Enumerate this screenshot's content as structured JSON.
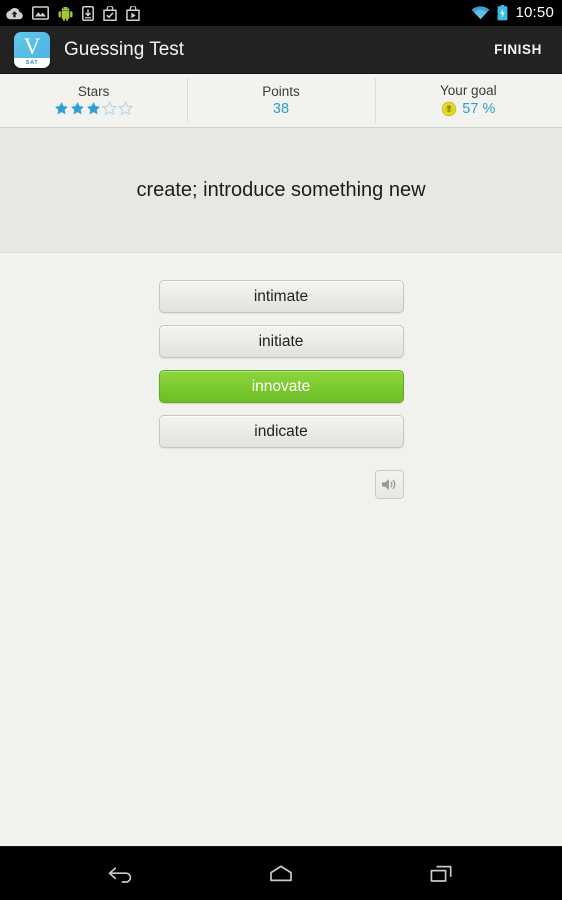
{
  "status_bar": {
    "icons": [
      "cloud-upload-icon",
      "photo-icon",
      "android-icon",
      "download-device-icon",
      "bag-check-icon",
      "bag-play-icon"
    ],
    "wifi_icon": "wifi-icon",
    "battery_icon": "battery-charging-icon",
    "time": "10:50"
  },
  "action_bar": {
    "app_icon": "app-logo-icon",
    "app_icon_letter": "V",
    "app_icon_sub": "SAT",
    "title": "Guessing Test",
    "finish_label": "FINISH"
  },
  "stats": [
    {
      "label": "Stars",
      "type": "stars",
      "filled": 3,
      "total": 5,
      "color": "#2f9fd4",
      "empty_color": "#c5dbe6"
    },
    {
      "label": "Points",
      "type": "number",
      "value": "38",
      "color": "#2f9fd4"
    },
    {
      "label": "Your goal",
      "type": "coin",
      "icon": "gold-coin-icon",
      "value": "57 %",
      "color": "#2f9fd4"
    }
  ],
  "question": {
    "text": "create; introduce something new"
  },
  "answers": [
    {
      "label": "intimate",
      "state": "default"
    },
    {
      "label": "initiate",
      "state": "default"
    },
    {
      "label": "innovate",
      "state": "correct"
    },
    {
      "label": "indicate",
      "state": "default"
    }
  ],
  "sound_button": {
    "icon": "speaker-icon"
  },
  "nav_bar": {
    "back": "back-icon",
    "home": "home-icon",
    "recents": "recents-icon"
  },
  "colors": {
    "accent_blue": "#2f9fd4",
    "correct_green": "#7ecb31",
    "action_bar_bg": "#222222",
    "question_bg": "#e8e8e3",
    "body_bg": "#f1f1ee"
  }
}
